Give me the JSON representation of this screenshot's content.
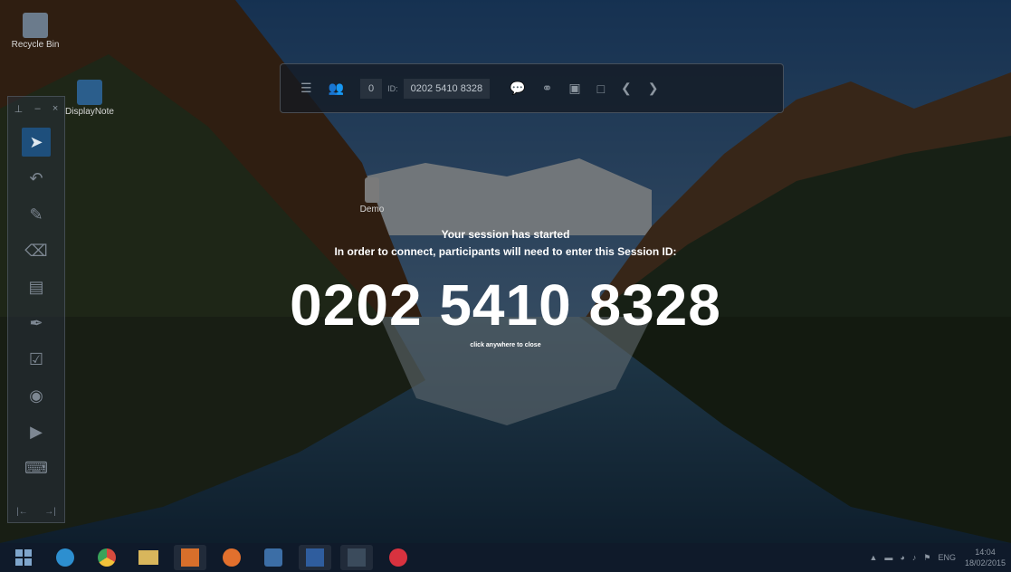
{
  "desktop": {
    "icons": [
      {
        "label": "Recycle Bin"
      },
      {
        "label": "DisplayNote"
      },
      {
        "label": "Demo"
      }
    ]
  },
  "toolbar": {
    "participants_count": "0",
    "id_label": "ID:",
    "session_id": "0202 5410 8328",
    "icons": [
      "mixer-icon",
      "participants-icon",
      "chat-icon",
      "mic-icon",
      "capture-icon",
      "window-icon",
      "prev-icon",
      "next-icon"
    ]
  },
  "left_panel": {
    "tools": [
      "pointer-icon",
      "undo-icon",
      "pen-icon",
      "eraser-icon",
      "notes-icon",
      "highlighter-icon",
      "edit-icon",
      "camera-icon",
      "video-icon",
      "keyboard-icon"
    ]
  },
  "overlay": {
    "title": "Your session has started",
    "instruction": "In order to connect, participants will need to enter this Session ID:",
    "session_id": "0202 5410 8328",
    "close_hint": "click anywhere to close"
  },
  "taskbar": {
    "language": "ENG",
    "time": "14:04",
    "date": "18/02/2015"
  },
  "colors": {
    "toolbar_bg": "#141a22",
    "active_tool": "#1e4f7c",
    "taskbar": "#0f1a2a"
  }
}
